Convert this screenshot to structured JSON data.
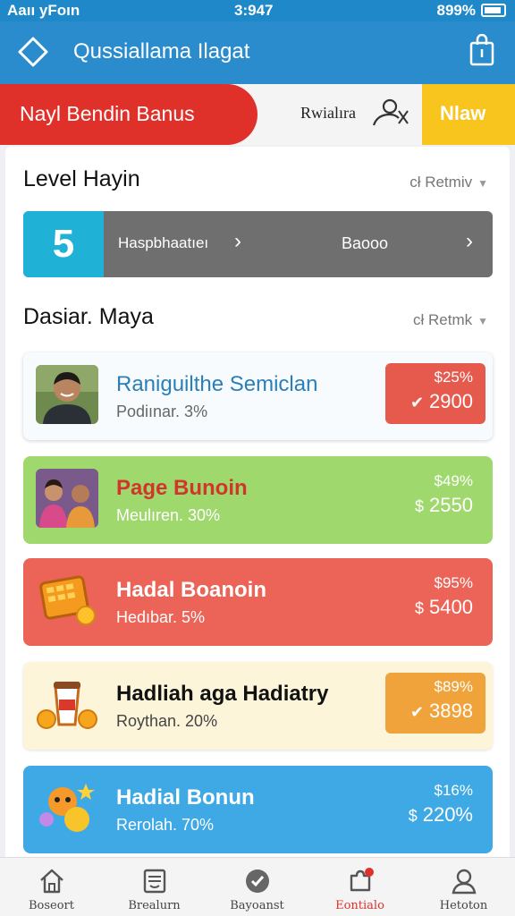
{
  "status": {
    "left": "Aaıı yFoın",
    "time": "3:947",
    "right": "899%"
  },
  "appbar": {
    "title": "Qussiallama Ilagat"
  },
  "banner": {
    "bonus_label": "Nayl Bendin Banus",
    "mid_text": "Rwialıra",
    "new_label": "Nlaw"
  },
  "level_section": {
    "title": "Level Hayin",
    "more": "cł Retmiv",
    "badge": "5",
    "label": "Haspbhaatıeı",
    "value": "Baooo"
  },
  "list_section": {
    "title": "Dasiar. Maya",
    "more": "cł Retmk"
  },
  "items": [
    {
      "name": "Raniguilthe Semiclan",
      "sub": "Podiınar. 3%",
      "price_top": "$25%",
      "price_main": "2900",
      "icon": "check-circle"
    },
    {
      "name": "Page Bunoin",
      "sub": "Meulıren. 30%",
      "price_top": "$49%",
      "price_main": "2550",
      "currency": "$"
    },
    {
      "name": "Hadal Boanoin",
      "sub": "Hedıbar. 5%",
      "price_top": "$95%",
      "price_main": "5400",
      "currency": "$"
    },
    {
      "name": "Hadliah aga Hadiatry",
      "sub": "Roythan. 20%",
      "price_top": "$89%",
      "price_main": "3898",
      "icon": "check-circle"
    },
    {
      "name": "Hadial Bonun",
      "sub": "Rerolah. 70%",
      "price_top": "$16%",
      "price_main": "220%",
      "currency": "$"
    }
  ],
  "nav": [
    {
      "label": "Boseort",
      "icon": "home-icon"
    },
    {
      "label": "Brealurn",
      "icon": "receipt-icon"
    },
    {
      "label": "Bayoanst",
      "icon": "check-icon"
    },
    {
      "label": "Eontialo",
      "icon": "puzzle-icon"
    },
    {
      "label": "Hetoton",
      "icon": "profile-icon"
    }
  ],
  "colors": {
    "primary": "#2a8ccc",
    "red": "#e0302a",
    "yellow": "#f7c51e",
    "green": "#9fd86c",
    "orange": "#f0a33a",
    "blue": "#3fa9e6"
  }
}
